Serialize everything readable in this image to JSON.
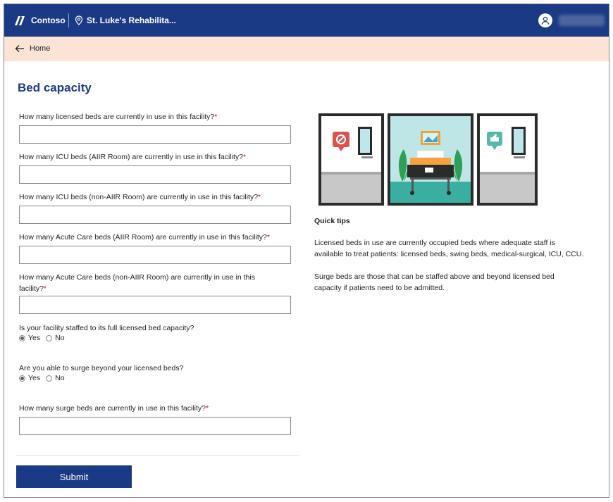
{
  "header": {
    "brand": "Contoso",
    "facility": "St. Luke's Rehabilita..."
  },
  "nav": {
    "back_label": "Home"
  },
  "page": {
    "title": "Bed capacity"
  },
  "questions": {
    "licensed": "How many licensed beds are currently in use in this facility?",
    "icu_aiir": "How many ICU beds (AIIR Room) are currently in use in this facility?",
    "icu_non_aiir": "How many ICU beds (non-AIIR Room) are currently in use in this facility?",
    "acute_aiir": "How many Acute Care beds (AIIR Room) are currently in use in this facility?",
    "acute_non_aiir_line1": "How many Acute Care beds (non-AIIR Room) are currently in use in this",
    "acute_non_aiir_line2": "facility?",
    "staffed": "Is your facility staffed to its full licensed bed capacity?",
    "surge_able": "Are you able to surge beyond your licensed beds?",
    "surge_count": "How many surge beds are currently in use in this facility?",
    "required_marker": "*"
  },
  "radio_options": {
    "yes": "Yes",
    "no": "No"
  },
  "radio_values": {
    "staffed": "Yes",
    "surge_able": "Yes"
  },
  "form": {
    "submit_label": "Submit"
  },
  "tips": {
    "title": "Quick tips",
    "p1_line1": "Licensed beds in use are currently occupied beds where adequate staff is",
    "p1_line2": "available to treat patients: licensed beds, swing beds, medical-surgical, ICU, CCU.",
    "p2_line1": "Surge beds are those that can be staffed above and beyond licensed bed",
    "p2_line2": "capacity if patients need to be admitted."
  },
  "icons": {
    "logo": "contoso-logo-icon",
    "location": "location-pin-icon",
    "back": "back-arrow-icon",
    "user": "user-avatar-icon"
  },
  "colors": {
    "header_bg": "#1b3a85",
    "nav_bg": "#fbe3d6",
    "accent": "#1b3a85",
    "required": "#c50f1f"
  }
}
